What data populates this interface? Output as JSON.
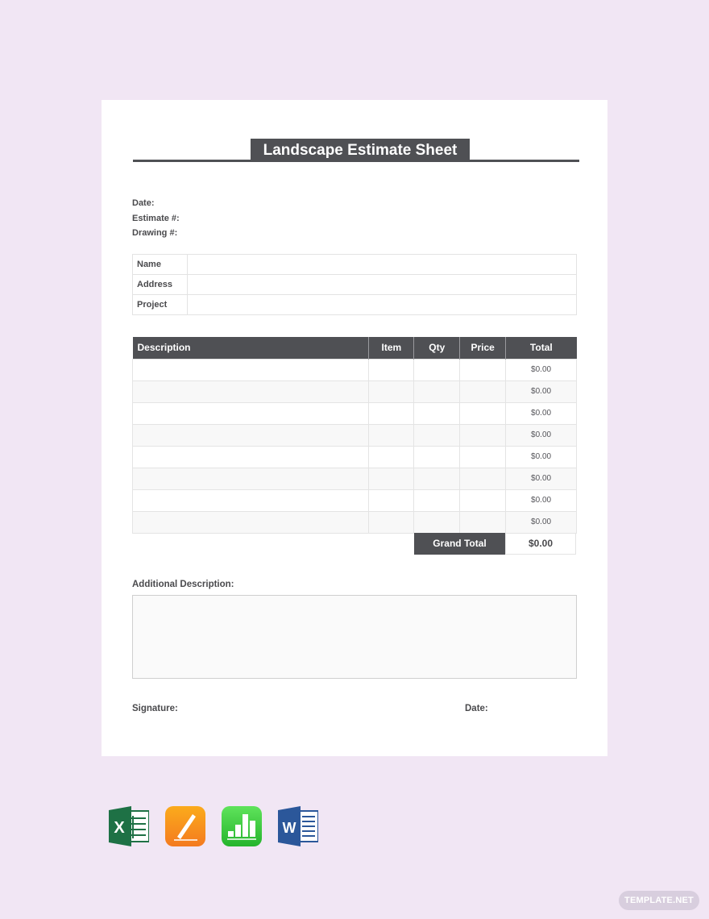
{
  "document": {
    "title": "Landscape Estimate Sheet",
    "meta_fields": [
      "Date:",
      "Estimate #:",
      "Drawing #:"
    ],
    "info_rows": [
      {
        "label": "Name",
        "value": ""
      },
      {
        "label": "Address",
        "value": ""
      },
      {
        "label": "Project",
        "value": ""
      }
    ],
    "items_table": {
      "columns": [
        "Description",
        "Item",
        "Qty",
        "Price",
        "Total"
      ],
      "rows": [
        {
          "description": "",
          "item": "",
          "qty": "",
          "price": "",
          "total": "$0.00"
        },
        {
          "description": "",
          "item": "",
          "qty": "",
          "price": "",
          "total": "$0.00"
        },
        {
          "description": "",
          "item": "",
          "qty": "",
          "price": "",
          "total": "$0.00"
        },
        {
          "description": "",
          "item": "",
          "qty": "",
          "price": "",
          "total": "$0.00"
        },
        {
          "description": "",
          "item": "",
          "qty": "",
          "price": "",
          "total": "$0.00"
        },
        {
          "description": "",
          "item": "",
          "qty": "",
          "price": "",
          "total": "$0.00"
        },
        {
          "description": "",
          "item": "",
          "qty": "",
          "price": "",
          "total": "$0.00"
        },
        {
          "description": "",
          "item": "",
          "qty": "",
          "price": "",
          "total": "$0.00"
        }
      ],
      "grand_total_label": "Grand Total",
      "grand_total_value": "$0.00"
    },
    "additional_description_label": "Additional Description:",
    "additional_description_value": "",
    "signature_label": "Signature:",
    "signature_date_label": "Date:"
  },
  "format_icons": [
    {
      "name": "excel-icon",
      "color": "#1e7145"
    },
    {
      "name": "pages-icon",
      "color": "#f7931e"
    },
    {
      "name": "numbers-icon",
      "color": "#3fc23c"
    },
    {
      "name": "word-icon",
      "color": "#2b579a"
    }
  ],
  "watermark": "TEMPLATE.NET",
  "colors": {
    "background": "#f1e6f4",
    "header": "#4f5054",
    "page": "#ffffff"
  }
}
